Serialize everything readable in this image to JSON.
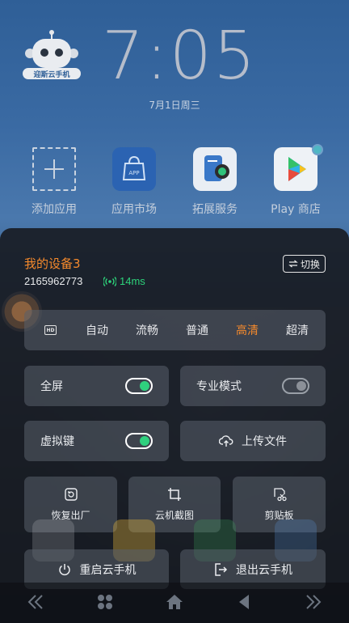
{
  "home": {
    "time": "7:05",
    "date": "7月1日周三",
    "robot_label": "迎斯云手机",
    "apps": [
      {
        "label": "添加应用",
        "icon": "add-app-icon"
      },
      {
        "label": "应用市场",
        "icon": "app-store-icon"
      },
      {
        "label": "拓展服务",
        "icon": "extension-service-icon"
      },
      {
        "label": "Play 商店",
        "icon": "play-store-icon"
      }
    ]
  },
  "panel": {
    "device_name": "我的设备3",
    "device_id": "2165962773",
    "ping": "14ms",
    "switch_label": "切换",
    "quality": {
      "icon": "hd-icon",
      "options": [
        "自动",
        "流畅",
        "普通",
        "高清",
        "超清"
      ],
      "selected": "高清"
    },
    "toggles": {
      "fullscreen": {
        "label": "全屏",
        "on": true
      },
      "pro_mode": {
        "label": "专业模式",
        "on": false
      },
      "virtual_keys": {
        "label": "虚拟键",
        "on": true
      }
    },
    "upload_label": "上传文件",
    "tiles": {
      "restore": "恢复出厂",
      "screenshot": "云机截图",
      "clipboard": "剪贴板"
    },
    "restart_label": "重启云手机",
    "exit_label": "退出云手机"
  },
  "colors": {
    "accent": "#f58a2c",
    "green": "#2fd07e",
    "panel_bg": "#171b21"
  }
}
